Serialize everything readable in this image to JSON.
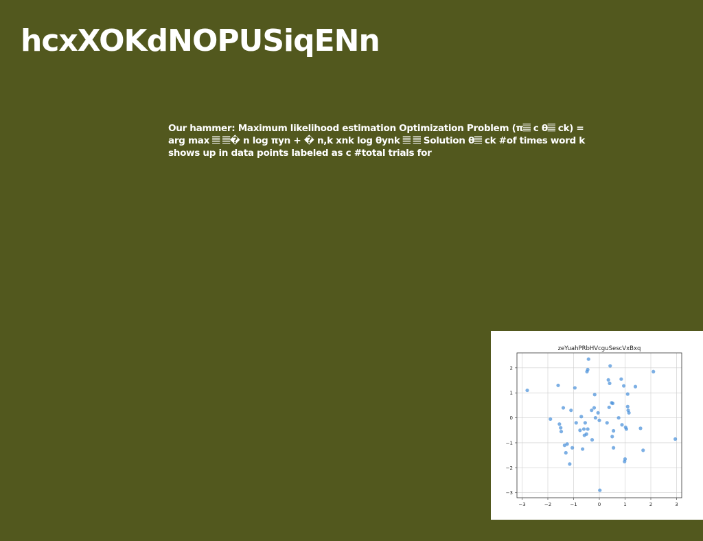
{
  "slide": {
    "title": "hcxXOKdNOPUSiqENn",
    "body": "Our hammer: Maximum likelihood estimation Optimization Problem (π𝄚 c θ𝄚 ck) = arg max 𝄚 𝄚� n log πyn + � n,k xnk log θynk 𝄚 𝄚 Solution θ𝄚 ck #of times word k shows up in data points labeled as c #total trials for"
  },
  "colors": {
    "background": "#52581e",
    "text": "#ffffff",
    "point": "#4a90d9"
  },
  "chart_data": {
    "type": "scatter",
    "title": "zeYuahPRbHVcguSescVxBxq",
    "xlabel": "",
    "ylabel": "",
    "xlim": [
      -3.2,
      3.2
    ],
    "ylim": [
      -3.2,
      2.6
    ],
    "xticks": [
      -3,
      -2,
      -1,
      0,
      1,
      2,
      3
    ],
    "yticks": [
      -3,
      -2,
      -1,
      0,
      1,
      2
    ],
    "grid": true,
    "points": [
      [
        -2.8,
        1.1
      ],
      [
        -1.9,
        -0.05
      ],
      [
        -1.6,
        1.3
      ],
      [
        -1.55,
        -0.25
      ],
      [
        -1.5,
        -0.4
      ],
      [
        -1.48,
        -0.55
      ],
      [
        -1.4,
        0.4
      ],
      [
        -1.35,
        -1.1
      ],
      [
        -1.3,
        -1.4
      ],
      [
        -1.25,
        -1.05
      ],
      [
        -1.15,
        -1.85
      ],
      [
        -1.1,
        0.3
      ],
      [
        -1.05,
        -1.2
      ],
      [
        -0.95,
        1.2
      ],
      [
        -0.9,
        -0.2
      ],
      [
        -0.75,
        -0.5
      ],
      [
        -0.7,
        0.05
      ],
      [
        -0.65,
        -1.25
      ],
      [
        -0.6,
        -0.45
      ],
      [
        -0.58,
        -0.7
      ],
      [
        -0.55,
        -0.2
      ],
      [
        -0.5,
        -0.65
      ],
      [
        -0.48,
        1.85
      ],
      [
        -0.45,
        1.93
      ],
      [
        -0.45,
        -0.45
      ],
      [
        -0.42,
        2.35
      ],
      [
        -0.3,
        0.3
      ],
      [
        -0.28,
        -0.88
      ],
      [
        -0.2,
        0.4
      ],
      [
        -0.18,
        0.93
      ],
      [
        -0.15,
        0.0
      ],
      [
        -0.05,
        0.2
      ],
      [
        0.0,
        -0.1
      ],
      [
        0.02,
        -2.9
      ],
      [
        0.3,
        -0.2
      ],
      [
        0.35,
        1.52
      ],
      [
        0.38,
        0.42
      ],
      [
        0.4,
        1.38
      ],
      [
        0.42,
        2.08
      ],
      [
        0.48,
        0.6
      ],
      [
        0.5,
        -0.75
      ],
      [
        0.52,
        0.58
      ],
      [
        0.55,
        -0.52
      ],
      [
        0.55,
        -1.2
      ],
      [
        0.75,
        0.0
      ],
      [
        0.85,
        1.55
      ],
      [
        0.88,
        -0.28
      ],
      [
        0.95,
        1.28
      ],
      [
        0.98,
        -1.75
      ],
      [
        1.0,
        -1.65
      ],
      [
        1.02,
        -0.38
      ],
      [
        1.05,
        -0.45
      ],
      [
        1.1,
        0.95
      ],
      [
        1.1,
        0.45
      ],
      [
        1.12,
        0.3
      ],
      [
        1.15,
        0.2
      ],
      [
        1.4,
        1.25
      ],
      [
        1.6,
        -0.42
      ],
      [
        1.7,
        -1.3
      ],
      [
        2.1,
        1.85
      ],
      [
        2.95,
        -0.85
      ]
    ]
  }
}
